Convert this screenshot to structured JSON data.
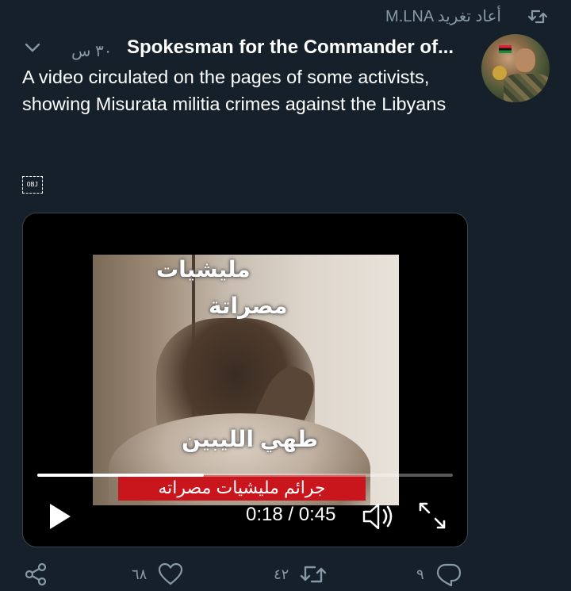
{
  "retweet_header": {
    "label": "M.LNA أعاد تغريد",
    "icon": "retweet-icon"
  },
  "tweet": {
    "display_name": "Spokesman for the Commander of...",
    "time": "٣٠ س",
    "text": "A video circulated on the pages of some activists, showing Misurata militia crimes against the Libyans",
    "embedded_object_label": "OBJ"
  },
  "video": {
    "overlay_lines": [
      "مليشيات",
      "مصراتة",
      "طهي الليبين"
    ],
    "banner_text": "جرائم مليشيات مصراته",
    "current_time": "0:18",
    "duration": "0:45",
    "time_display": "0:18 / 0:45",
    "progress_fraction": 0.4,
    "controls": [
      "play-icon",
      "volume-icon",
      "fullscreen-icon"
    ]
  },
  "actions": {
    "reply_count": "٩",
    "retweet_count": "٤٢",
    "like_count": "٦٨",
    "share_icon": "share-icon"
  },
  "colors": {
    "background": "#15202b",
    "secondary_text": "#8899a6",
    "banner": "#c9161d"
  }
}
